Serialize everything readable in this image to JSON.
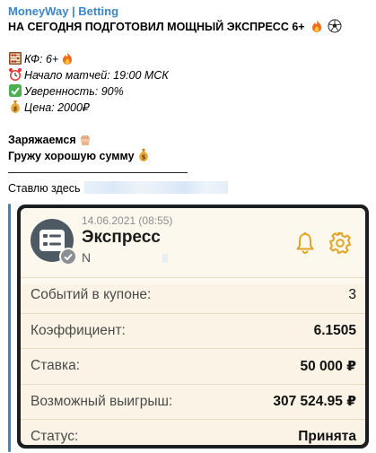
{
  "message": {
    "author": "MoneyWay | Betting",
    "headline": "НА СЕГОДНЯ ПОДГОТОВИЛ МОЩНЫЙ ЭКСПРЕСС 6+",
    "coef": "КФ: 6+",
    "start": "Начало матчей: 19:00 МСК",
    "confidence": "Уверенность: 90%",
    "price": "Цена: 2000₽",
    "charge": "Заряжаемся",
    "load": "Гружу хорошую сумму",
    "divider": "————————————————",
    "bet_here": "Ставлю здесь"
  },
  "coupon": {
    "date": "14.06.2021 (08:55)",
    "title": "Экспресс",
    "subtitle": "N",
    "rows": [
      {
        "label": "Событий в купоне:",
        "value": "3"
      },
      {
        "label": "Коэффициент:",
        "value": "6.1505"
      },
      {
        "label": "Ставка:",
        "value": "50 000 ₽"
      },
      {
        "label": "Возможный выигрыш:",
        "value": "307 524.95 ₽"
      },
      {
        "label": "Статус:",
        "value": "Принята"
      }
    ]
  },
  "colors": {
    "accent": "#3a86c8",
    "card_bg": "#fbf4e6",
    "icon_gold": "#e0a526"
  }
}
